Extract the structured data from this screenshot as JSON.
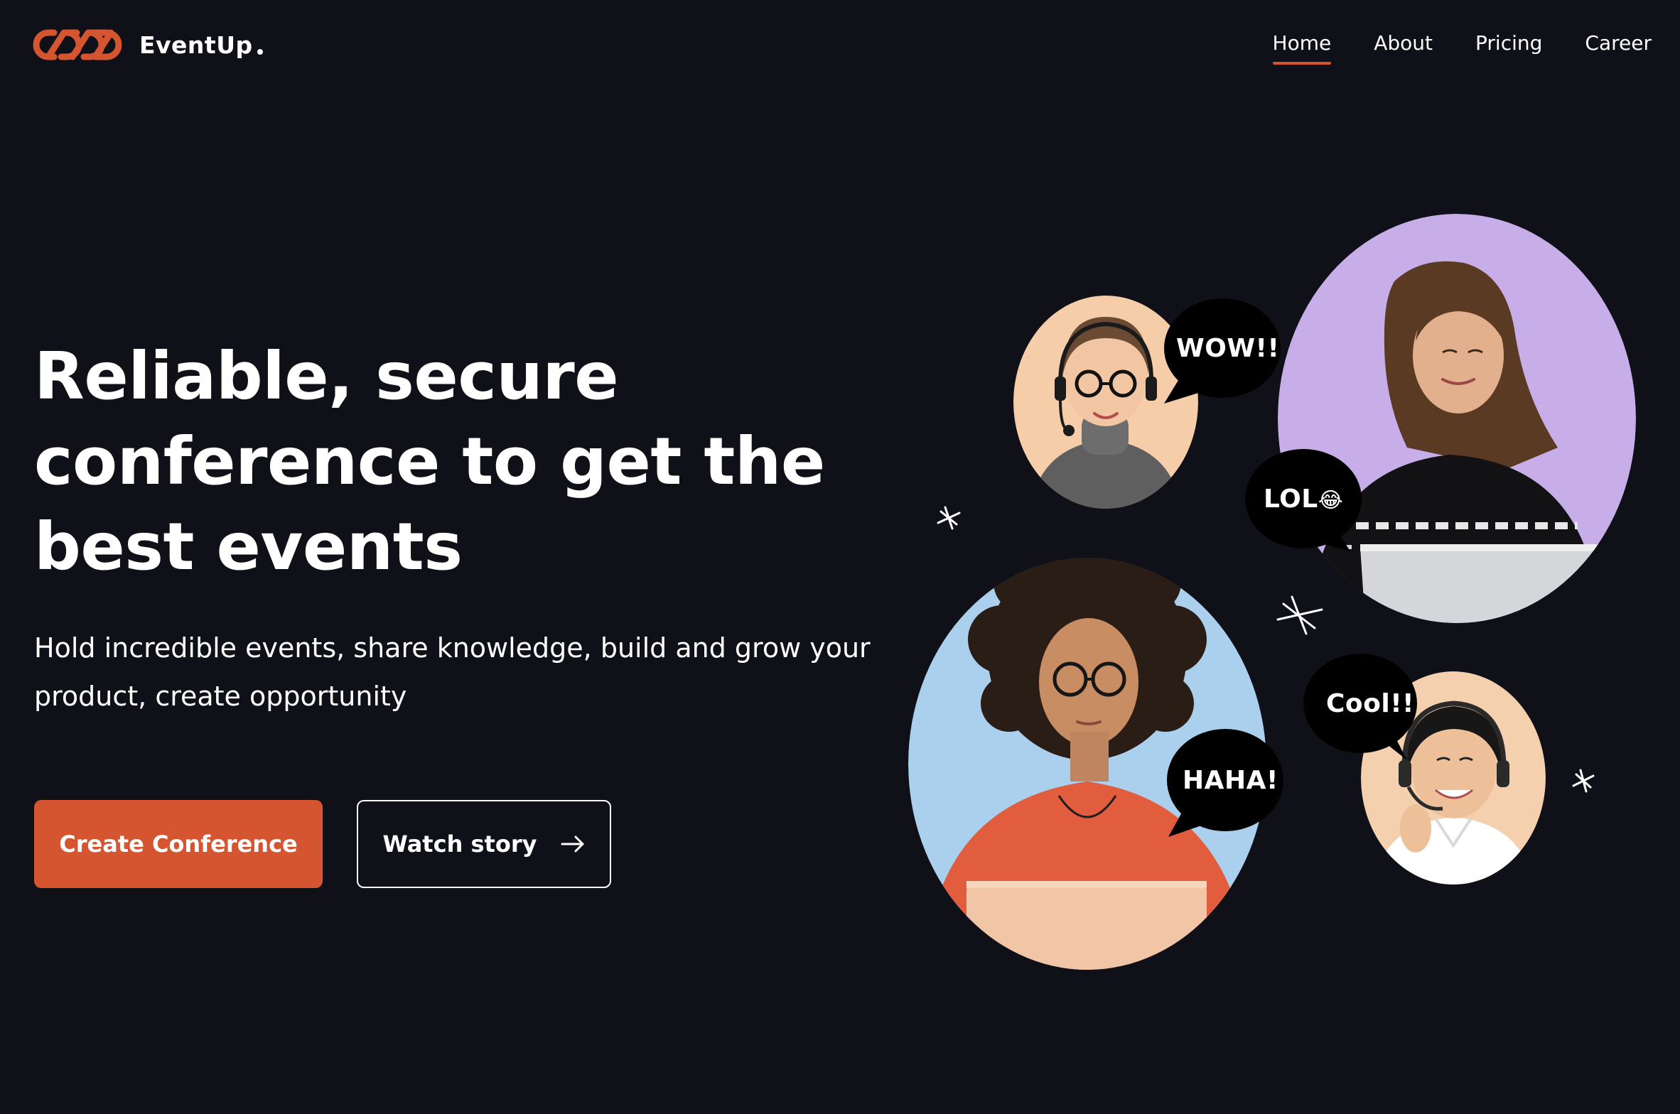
{
  "brand": {
    "name": "EventUp",
    "logo_icon": "chain-links-logo-icon",
    "accent_color": "#d4552f"
  },
  "nav": {
    "items": [
      {
        "label": "Home",
        "active": true
      },
      {
        "label": "About",
        "active": false
      },
      {
        "label": "Pricing",
        "active": false
      },
      {
        "label": "Career",
        "active": false
      }
    ]
  },
  "hero": {
    "headline": "Reliable, secure conference to get the best events",
    "subtitle": "Hold incredible events, share knowledge, build and grow your product, create opportunity",
    "primary_button": "Create Conference",
    "secondary_button": "Watch story",
    "secondary_icon": "arrow-right-icon"
  },
  "illustration": {
    "bubbles": {
      "wow": "WOW!!",
      "lol": "LOL",
      "lol_emoji": "😂",
      "cool": "Cool!!",
      "haha": "HAHA!"
    },
    "circle_colors": {
      "peach": "#f5cda8",
      "lavender": "#c7aee8",
      "sky": "#aad0ee",
      "apricot": "#f4d0ae"
    }
  }
}
